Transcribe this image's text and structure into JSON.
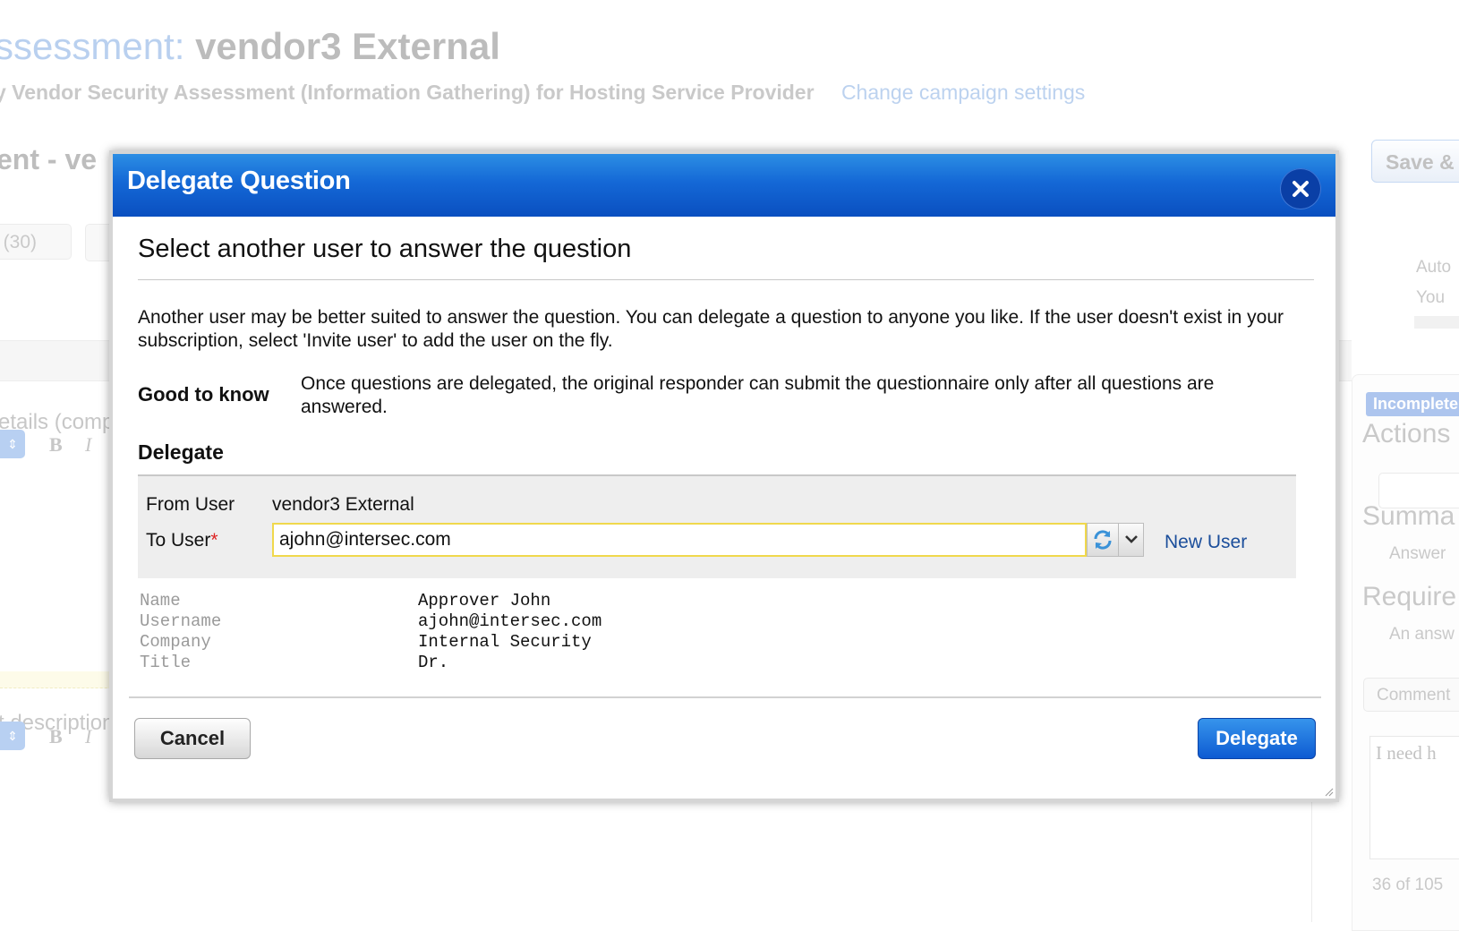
{
  "background": {
    "title_prefix": "ssessment:",
    "title_name": "vendor3 External",
    "subtitle": "y Vendor Security Assessment (Information Gathering) for Hosting Service Provider",
    "change_link": "Change campaign settings",
    "section_title": "ent - ve",
    "tab_label": "e (30)",
    "details_label": "etails (comp",
    "description_label": "t description",
    "save_label": "Save &",
    "auto_text": "Auto",
    "you_text": "You",
    "right_panel": {
      "badge": "Incomplete",
      "actions": "Actions",
      "summary": "Summa",
      "answer": "Answer",
      "required": "Require",
      "an_answer": "An answ",
      "comment": "Comment",
      "textarea": "I need h",
      "count": "36 of 105"
    }
  },
  "modal": {
    "title": "Delegate Question",
    "heading": "Select another user to answer the question",
    "intro": "Another user may be better suited to answer the question. You can delegate a question to anyone you like. If the user doesn't exist in your subscription, select 'Invite user' to add the user on the fly.",
    "good_to_know_label": "Good to know",
    "good_to_know_text": "Once questions are delegated, the original responder can submit the questionnaire only after all questions are answered.",
    "delegate_label": "Delegate",
    "from_user_label": "From User",
    "from_user_value": "vendor3 External",
    "to_user_label": "To User",
    "to_user_required": "*",
    "to_user_value": "ajohn@intersec.com",
    "new_user_link": "New User",
    "user_info": [
      {
        "key": "Name",
        "value": "Approver John"
      },
      {
        "key": "Username",
        "value": "ajohn@intersec.com"
      },
      {
        "key": "Company",
        "value": "Internal Security"
      },
      {
        "key": "Title",
        "value": "Dr."
      }
    ],
    "cancel_label": "Cancel",
    "delegate_button_label": "Delegate"
  },
  "colors": {
    "header_blue": "#1468d6",
    "link_blue": "#1b4e9b",
    "input_highlight": "#f0d84c"
  },
  "icons": {
    "close": "close-icon",
    "refresh": "refresh-icon",
    "dropdown": "chevron-down-icon",
    "bold": "bold-icon",
    "italic": "italic-icon"
  }
}
